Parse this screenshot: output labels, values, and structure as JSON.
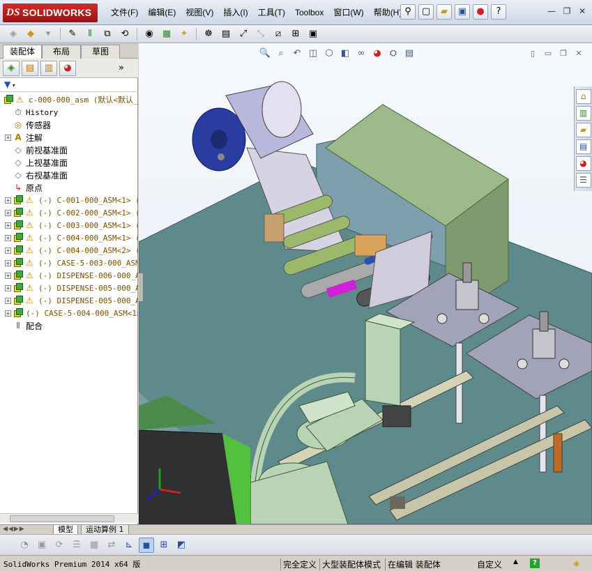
{
  "app": {
    "brand": "SOLIDWORKS",
    "brand_prefix": "DS"
  },
  "menu": [
    "文件(F)",
    "编辑(E)",
    "视图(V)",
    "插入(I)",
    "工具(T)",
    "Toolbox",
    "窗口(W)",
    "帮助(H)"
  ],
  "panel_tabs": [
    "装配体",
    "布局",
    "草图"
  ],
  "filter_icon": "funnel-icon",
  "tree": [
    {
      "label": "c-000-000_asm  (默认<默认_",
      "kind": "root"
    },
    {
      "label": "History",
      "kind": "history"
    },
    {
      "label": "传感器",
      "kind": "sensor"
    },
    {
      "label": "注解",
      "kind": "annotation"
    },
    {
      "label": "前视基准面",
      "kind": "plane"
    },
    {
      "label": "上视基准面",
      "kind": "plane"
    },
    {
      "label": "右视基准面",
      "kind": "plane"
    },
    {
      "label": "原点",
      "kind": "origin"
    },
    {
      "label": "(-) C-001-000_ASM<1> (",
      "kind": "asm"
    },
    {
      "label": "(-) C-002-000_ASM<1> (",
      "kind": "asm"
    },
    {
      "label": "(-) C-003-000_ASM<1> (",
      "kind": "asm"
    },
    {
      "label": "(-) C-004-000_ASM<1> (",
      "kind": "asm"
    },
    {
      "label": "(-) C-004-000_ASM<2> (",
      "kind": "asm"
    },
    {
      "label": "(-) CASE-5-003-000_ASM<",
      "kind": "asm"
    },
    {
      "label": "(-) DISPENSE-006-000_AS",
      "kind": "asm"
    },
    {
      "label": "(-) DISPENSE-005-000_AS",
      "kind": "asm"
    },
    {
      "label": "(-) DISPENSE-005-000_AS",
      "kind": "asm"
    },
    {
      "label": "(-) CASE-5-004-000_ASM<1>",
      "kind": "asm-ok"
    },
    {
      "label": "配合",
      "kind": "mates"
    }
  ],
  "bottom_tabs": [
    "模型",
    "运动算例 1"
  ],
  "status": {
    "product": "SolidWorks Premium 2014 x64 版",
    "definition": "完全定义",
    "mode": "大型装配体模式",
    "editing": "在编辑 装配体",
    "units": "自定义",
    "help": "?"
  },
  "colors": {
    "brand_red": "#c0201f",
    "warning": "#d08000",
    "viewport_bg": "#eef3f9",
    "floor": "#5f8a8c",
    "cabinet_green": "#8faa7e",
    "robot_green": "#b8d4b4"
  }
}
